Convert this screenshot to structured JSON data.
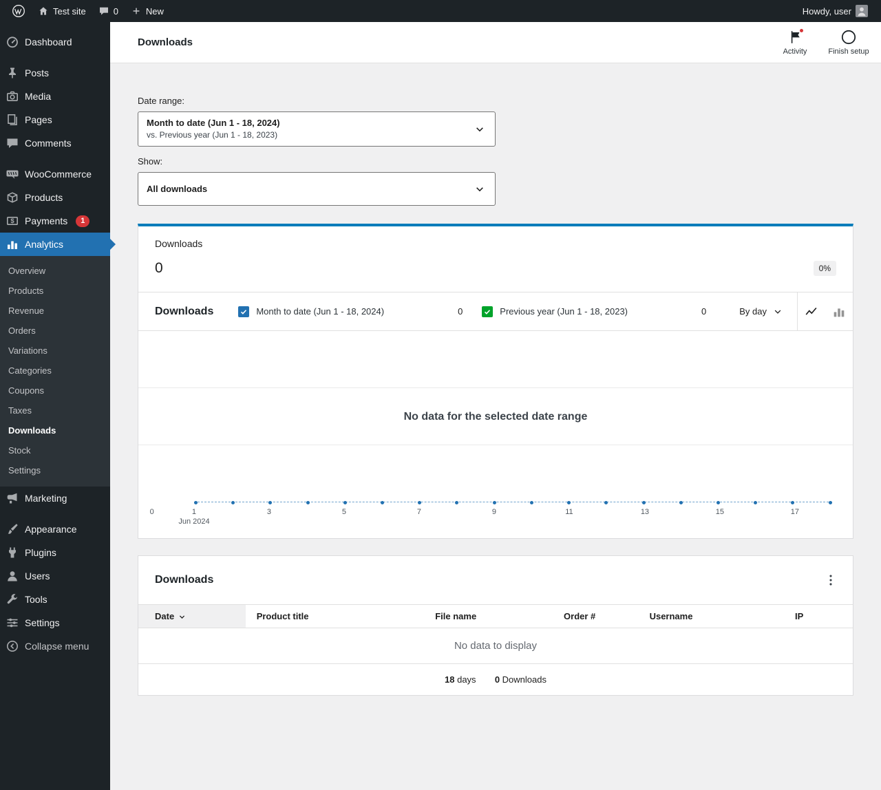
{
  "colors": {
    "accent": "#2271b1",
    "summary-accent": "#007cba",
    "series1": "#2271b1",
    "series2": "#00a32a",
    "alert": "#d63638"
  },
  "admin_bar": {
    "site_name": "Test site",
    "comments_count": "0",
    "new_label": "New",
    "howdy": "Howdy, user"
  },
  "sidebar": {
    "top": [
      {
        "label": "Dashboard"
      },
      {
        "label": "Posts"
      },
      {
        "label": "Media"
      },
      {
        "label": "Pages"
      },
      {
        "label": "Comments"
      },
      {
        "label": "WooCommerce"
      },
      {
        "label": "Products"
      },
      {
        "label": "Payments",
        "badge": "1"
      },
      {
        "label": "Analytics"
      }
    ],
    "submenu": [
      {
        "label": "Overview"
      },
      {
        "label": "Products"
      },
      {
        "label": "Revenue"
      },
      {
        "label": "Orders"
      },
      {
        "label": "Variations"
      },
      {
        "label": "Categories"
      },
      {
        "label": "Coupons"
      },
      {
        "label": "Taxes"
      },
      {
        "label": "Downloads"
      },
      {
        "label": "Stock"
      },
      {
        "label": "Settings"
      }
    ],
    "bottom": [
      {
        "label": "Marketing"
      },
      {
        "label": "Appearance"
      },
      {
        "label": "Plugins"
      },
      {
        "label": "Users"
      },
      {
        "label": "Tools"
      },
      {
        "label": "Settings"
      }
    ],
    "collapse_label": "Collapse menu"
  },
  "header": {
    "title": "Downloads",
    "activity_label": "Activity",
    "finish_setup_label": "Finish setup"
  },
  "filters": {
    "date_range_label": "Date range:",
    "date_range_value": "Month to date (Jun 1 - 18, 2024)",
    "date_range_compare": "vs. Previous year (Jun 1 - 18, 2023)",
    "show_label": "Show:",
    "show_value": "All downloads"
  },
  "summary": {
    "label": "Downloads",
    "value": "0",
    "delta": "0%"
  },
  "chart": {
    "title": "Downloads",
    "legend": [
      {
        "label": "Month to date (Jun 1 - 18, 2024)",
        "value": "0"
      },
      {
        "label": "Previous year (Jun 1 - 18, 2023)",
        "value": "0"
      }
    ],
    "interval": "By day",
    "empty_message": "No data for the selected date range",
    "y_zero": "0",
    "x_ticks": [
      "1",
      "3",
      "5",
      "7",
      "9",
      "11",
      "13",
      "15",
      "17"
    ],
    "x_sublabel": "Jun 2024"
  },
  "chart_data": {
    "type": "line",
    "title": "Downloads",
    "x": [
      1,
      2,
      3,
      4,
      5,
      6,
      7,
      8,
      9,
      10,
      11,
      12,
      13,
      14,
      15,
      16,
      17,
      18
    ],
    "xlabel": "Jun 2024",
    "ylim": [
      0,
      1
    ],
    "series": [
      {
        "name": "Month to date (Jun 1 - 18, 2024)",
        "values": [
          0,
          0,
          0,
          0,
          0,
          0,
          0,
          0,
          0,
          0,
          0,
          0,
          0,
          0,
          0,
          0,
          0,
          0
        ]
      },
      {
        "name": "Previous year (Jun 1 - 18, 2023)",
        "values": [
          0,
          0,
          0,
          0,
          0,
          0,
          0,
          0,
          0,
          0,
          0,
          0,
          0,
          0,
          0,
          0,
          0,
          0
        ]
      }
    ],
    "empty_message": "No data for the selected date range"
  },
  "table": {
    "title": "Downloads",
    "columns": [
      "Date",
      "Product title",
      "File name",
      "Order #",
      "Username",
      "IP"
    ],
    "empty_message": "No data to display",
    "summary": {
      "days_value": "18",
      "days_label": "days",
      "downloads_value": "0",
      "downloads_label": "Downloads"
    }
  }
}
